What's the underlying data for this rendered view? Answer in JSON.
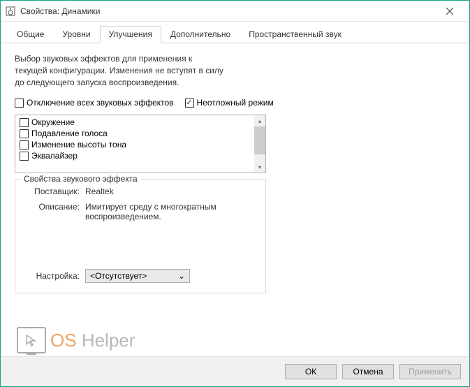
{
  "window": {
    "title": "Свойства: Динамики"
  },
  "tabs": [
    {
      "label": "Общие",
      "active": false
    },
    {
      "label": "Уровни",
      "active": false
    },
    {
      "label": "Улучшения",
      "active": true
    },
    {
      "label": "Дополнительно",
      "active": false
    },
    {
      "label": "Пространственный звук",
      "active": false
    }
  ],
  "description": "Выбор звуковых эффектов для применения к текущей конфигурации. Изменения не вступят в силу до следующего запуска воспроизведения.",
  "checkboxes": {
    "disable_all": {
      "label": "Отключение всех звуковых эффектов",
      "checked": false
    },
    "immediate": {
      "label": "Неотложный режим",
      "checked": true
    }
  },
  "effects": [
    {
      "label": "Окружение",
      "checked": false
    },
    {
      "label": "Подавление голоса",
      "checked": false
    },
    {
      "label": "Изменение высоты тона",
      "checked": false
    },
    {
      "label": "Эквалайзер",
      "checked": false
    }
  ],
  "properties_group": {
    "legend": "Свойства звукового эффекта",
    "vendor_label": "Поставщик:",
    "vendor_value": "Realtek",
    "description_label": "Описание:",
    "description_value": "Имитирует среду с многократным воспроизведением.",
    "setting_label": "Настройка:",
    "setting_value": "<Отсутствует>"
  },
  "buttons": {
    "ok": "ОК",
    "cancel": "Отмена",
    "apply": "Применить"
  },
  "watermark": {
    "os": "OS",
    "helper": "Helper"
  }
}
